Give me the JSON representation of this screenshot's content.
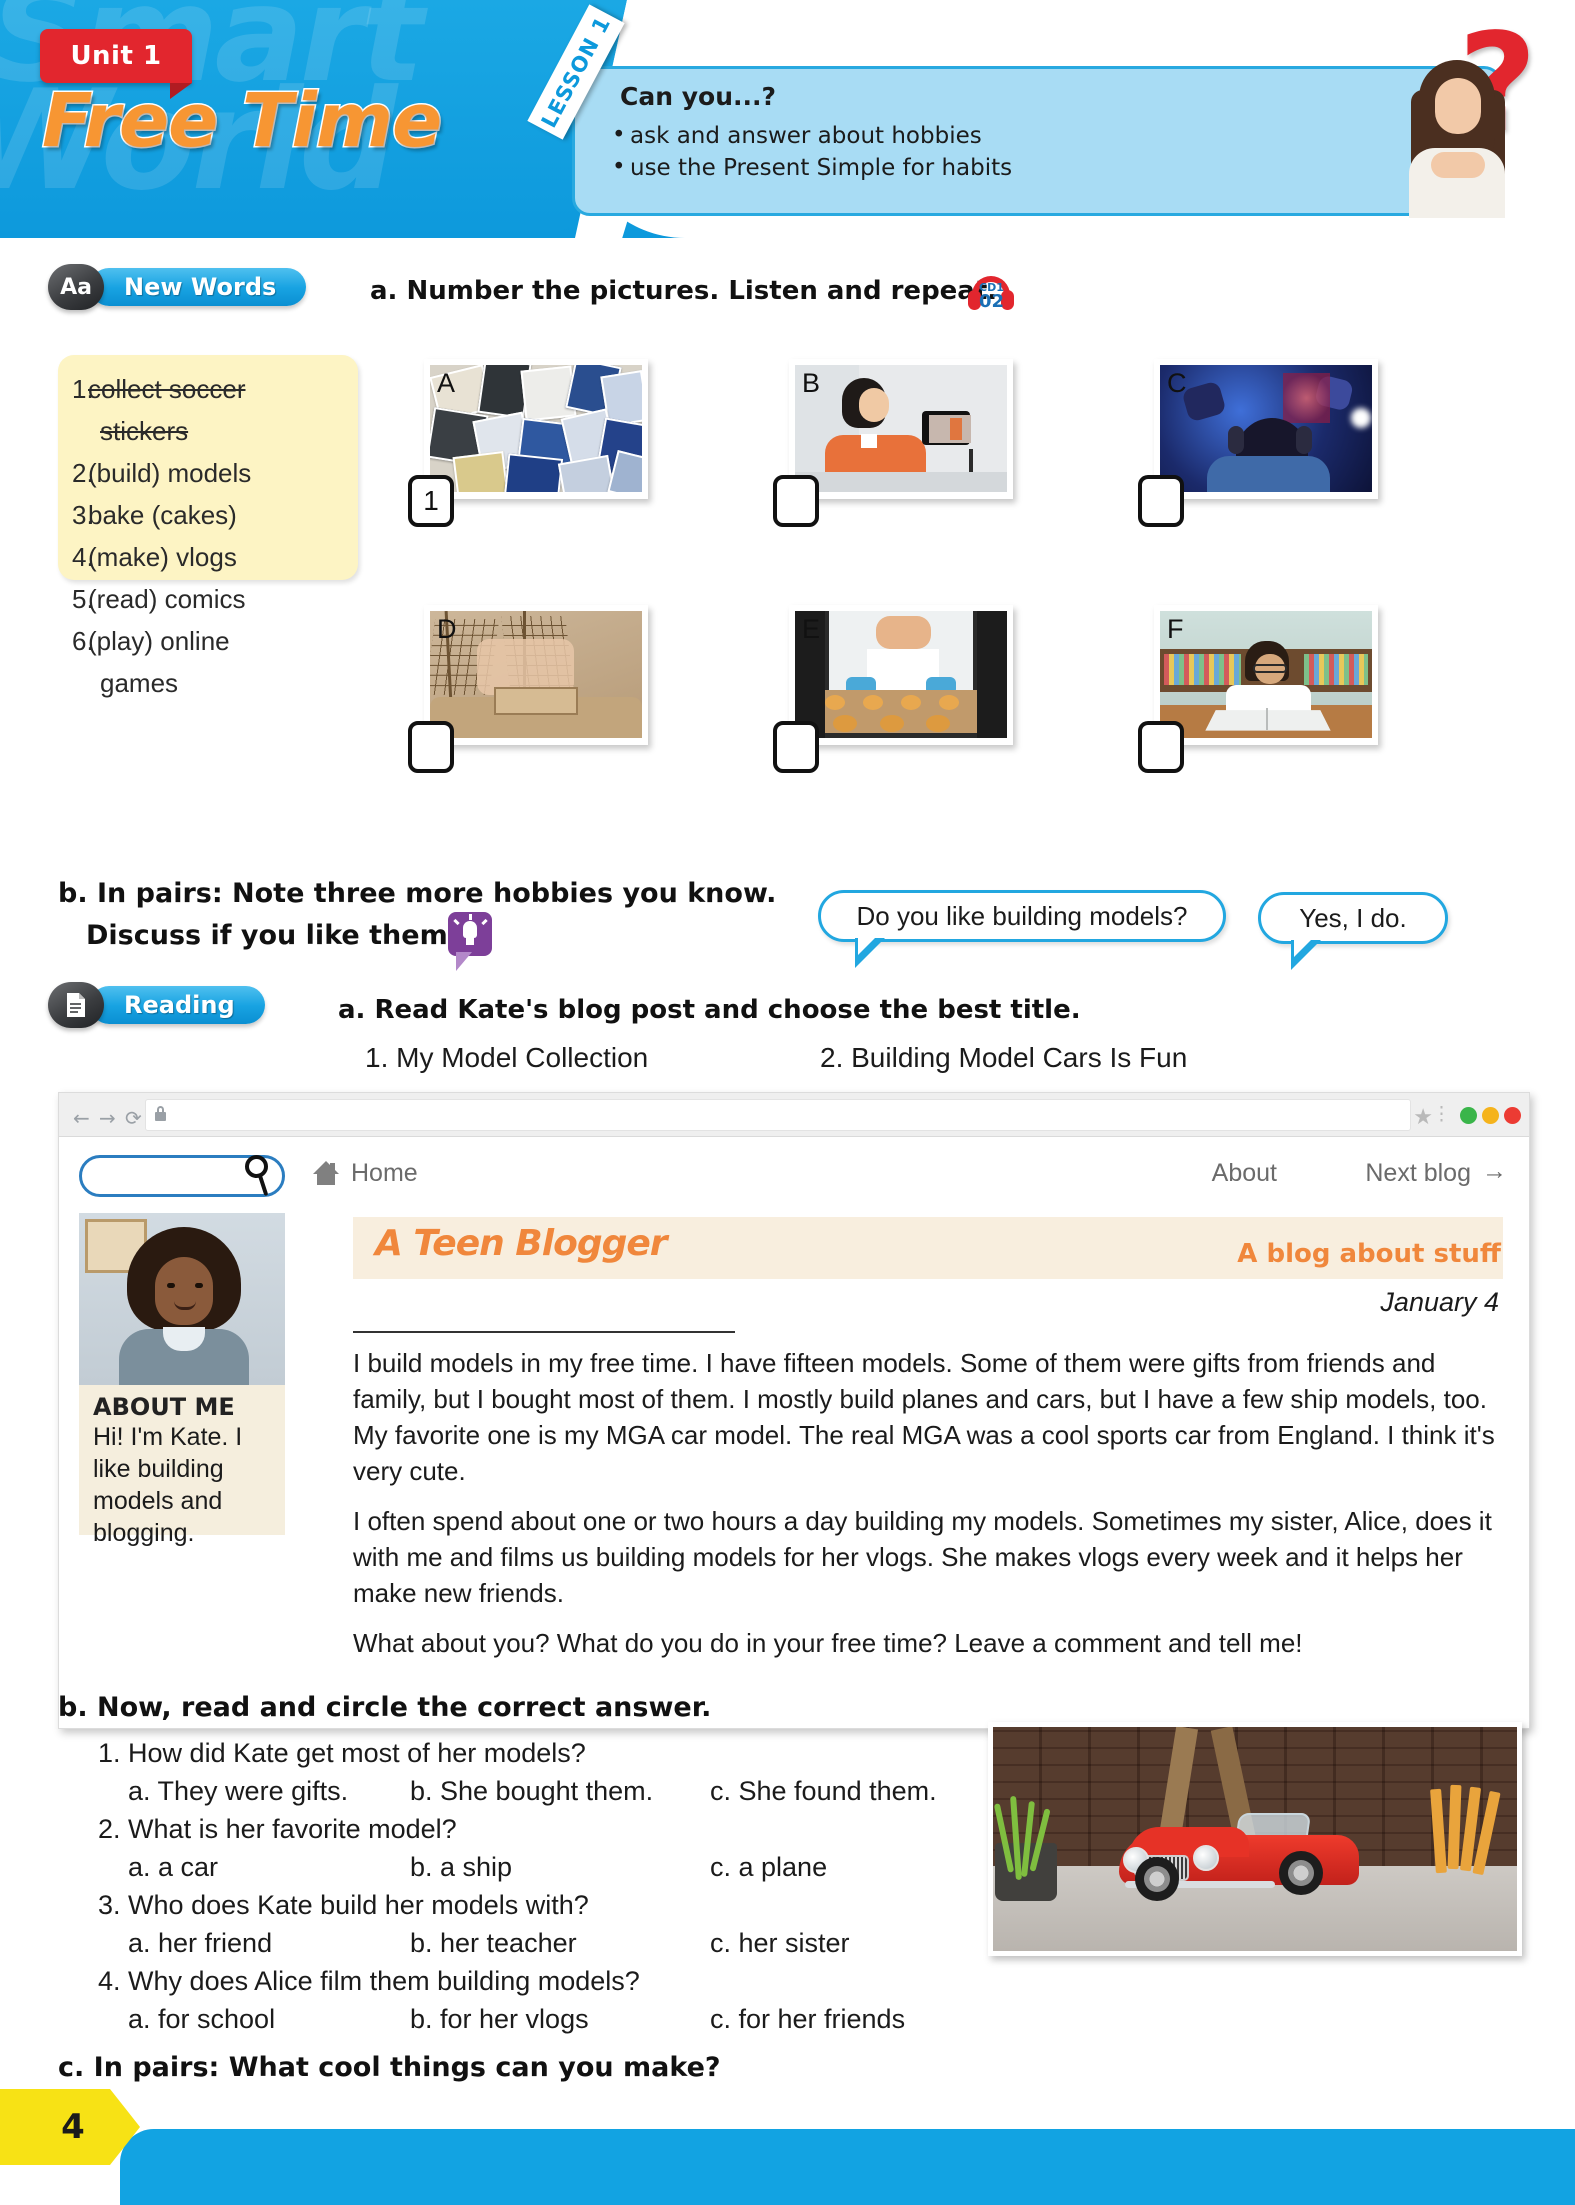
{
  "header": {
    "unit_tag": "Unit 1",
    "unit_title": "Free Time",
    "lesson_ribbon": "LESSON 1",
    "canyou_title": "Can you...?",
    "canyou_items": [
      "ask and answer about hobbies",
      "use the Present Simple for habits"
    ],
    "qmark": "?"
  },
  "new_words": {
    "tag_icon": "Aa",
    "tag_label": "New Words",
    "instruction": "a. Number the pictures. Listen and repeat.",
    "audio": {
      "cd": "CD1",
      "track": "02"
    },
    "word_list": [
      {
        "num": "1.",
        "text": "collect soccer",
        "text2": "stickers",
        "struck": true
      },
      {
        "num": "2.",
        "text": "(build) models",
        "struck": false
      },
      {
        "num": "3.",
        "text": "bake (cakes)",
        "struck": false
      },
      {
        "num": "4.",
        "text": "(make) vlogs",
        "struck": false
      },
      {
        "num": "5.",
        "text": "(read) comics",
        "struck": false
      },
      {
        "num": "6.",
        "text": "(play) online",
        "text2": "games",
        "struck": false
      }
    ],
    "pictures": [
      {
        "letter": "A",
        "number": "1",
        "scene": "soccer-stickers-collage"
      },
      {
        "letter": "B",
        "number": "",
        "scene": "girl-filming-vlog"
      },
      {
        "letter": "C",
        "number": "",
        "scene": "gamer-with-headset"
      },
      {
        "letter": "D",
        "number": "",
        "scene": "hands-building-ship-model"
      },
      {
        "letter": "E",
        "number": "",
        "scene": "woman-baking-cookies"
      },
      {
        "letter": "F",
        "number": "",
        "scene": "boy-reading-comic-book"
      }
    ],
    "pairwork": {
      "line1": "b. In pairs: Note three more hobbies you know.",
      "line2": "Discuss if you like them.",
      "bubble_q": "Do you like building models?",
      "bubble_a": "Yes, I do."
    }
  },
  "reading": {
    "tag_icon": "doc",
    "tag_label": "Reading",
    "instruction": "a. Read Kate's blog post and choose the best title.",
    "title_options": [
      "1. My Model Collection",
      "2. Building Model Cars Is Fun"
    ],
    "browser": {
      "back_icon": "←",
      "forward_icon": "→",
      "reload_icon": "⟳",
      "url_value": "",
      "star_icon": "★",
      "menu_icon": "⋮",
      "search_value": "",
      "home_label": "Home",
      "nav_about": "About",
      "nav_next": "Next blog",
      "nav_next_arrow": "→"
    },
    "blog": {
      "title": "A Teen Blogger",
      "subtitle": "A blog about stuff",
      "date": "January 4",
      "about_title": "ABOUT ME",
      "about_text": "Hi! I'm Kate. I like building models and blogging.",
      "paragraphs": [
        "I build models in my free time. I have fifteen models. Some of them were gifts from friends and family, but I bought most of them. I mostly build planes and cars, but I have a few ship models, too. My favorite one is my MGA car model. The real MGA was a cool sports car from England. I think it's very cute.",
        "I often spend about one or two hours a day building my models. Sometimes my sister, Alice, does it with me and films us building models for her vlogs. She makes vlogs every week and it helps her make new friends.",
        "What about you? What do you do in your free time? Leave a comment and tell me!"
      ]
    },
    "questions_heading": "b. Now, read and circle the correct answer.",
    "questions": [
      {
        "num": "1.",
        "prompt": "How did Kate get most of her models?",
        "options": [
          "a. They were gifts.",
          "b. She bought them.",
          "c. She found them."
        ]
      },
      {
        "num": "2.",
        "prompt": "What is her favorite model?",
        "options": [
          "a. a car",
          "b. a ship",
          "c. a plane"
        ]
      },
      {
        "num": "3.",
        "prompt": "Who does Kate build her models with?",
        "options": [
          "a. her friend",
          "b. her teacher",
          "c. her sister"
        ]
      },
      {
        "num": "4.",
        "prompt": "Why does Alice film them building models?",
        "options": [
          "a. for school",
          "b. for her vlogs",
          "c. for her friends"
        ]
      }
    ],
    "car_photo_caption": "red-mga-model-car",
    "pairwork_c": "c. In pairs: What cool things can you make?"
  },
  "footer": {
    "page_number": "4"
  },
  "colors": {
    "brand_blue": "#12a3e2",
    "accent_orange": "#f0873c",
    "tag_red": "#e2262e",
    "note_yellow": "#fdf4c4",
    "footer_yellow": "#f7e215",
    "bubble_border": "#22a7e0"
  }
}
